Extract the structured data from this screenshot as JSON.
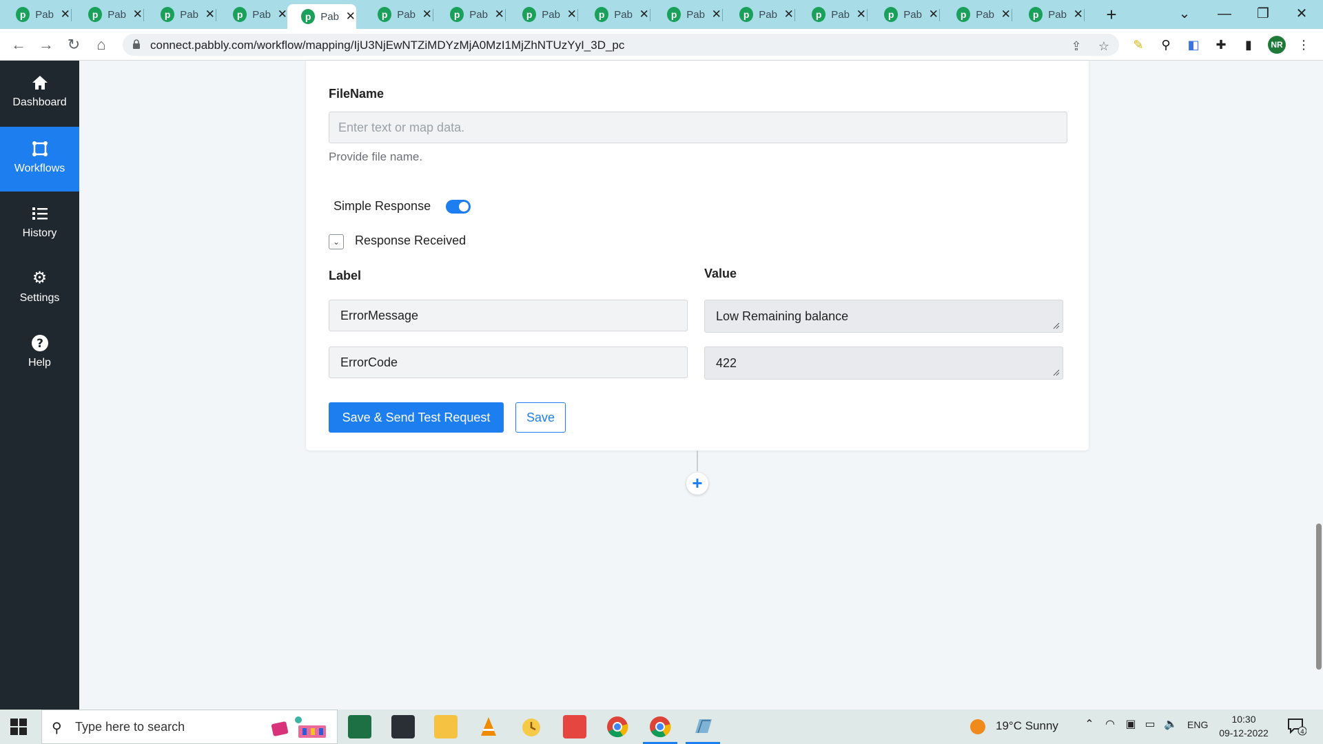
{
  "browser": {
    "tabs": [
      {
        "title": "Pab"
      },
      {
        "title": "Pab"
      },
      {
        "title": "Pab"
      },
      {
        "title": "Pab"
      },
      {
        "title": "Pab"
      },
      {
        "title": "Pab"
      },
      {
        "title": "Pab"
      },
      {
        "title": "Pab"
      },
      {
        "title": "Pab"
      },
      {
        "title": "Pab"
      },
      {
        "title": "Pab"
      },
      {
        "title": "Pab"
      },
      {
        "title": "Pab"
      },
      {
        "title": "Pab"
      },
      {
        "title": "Pab"
      }
    ],
    "active_tab_index": 4,
    "favicon_letter": "p",
    "close_glyph": "✕",
    "new_tab_glyph": "+",
    "url": "connect.pabbly.com/workflow/mapping/IjU3NjEwNTZiMDYzMjA0MzI1MjZhNTUzYyI_3D_pc",
    "profile_initials": "NR"
  },
  "sidebar": {
    "items": [
      {
        "label": "Dashboard",
        "icon": "home-icon"
      },
      {
        "label": "Workflows",
        "icon": "workflow-icon",
        "active": true
      },
      {
        "label": "History",
        "icon": "list-icon"
      },
      {
        "label": "Settings",
        "icon": "gear-icon"
      },
      {
        "label": "Help",
        "icon": "help-icon"
      }
    ]
  },
  "form": {
    "filename": {
      "label": "FileName",
      "placeholder": "Enter text or map data.",
      "help": "Provide file name."
    },
    "simple_response": {
      "label": "Simple Response",
      "enabled": true
    },
    "response_received": {
      "label": "Response Received"
    },
    "table": {
      "label_header": "Label",
      "value_header": "Value",
      "rows": [
        {
          "label": "ErrorMessage",
          "value": "Low Remaining balance"
        },
        {
          "label": "ErrorCode",
          "value": "422"
        }
      ]
    },
    "buttons": {
      "save_send": "Save & Send Test Request",
      "save": "Save"
    },
    "add_step_glyph": "+"
  },
  "taskbar": {
    "search_placeholder": "Type here to search",
    "weather": "19°C  Sunny",
    "language": "ENG",
    "time": "10:30",
    "date": "09-12-2022",
    "notification_count": "4"
  },
  "colors": {
    "accent": "#1d7ef0",
    "sidebar_bg": "#1f272f",
    "tabstrip_bg": "#a8dde8"
  }
}
